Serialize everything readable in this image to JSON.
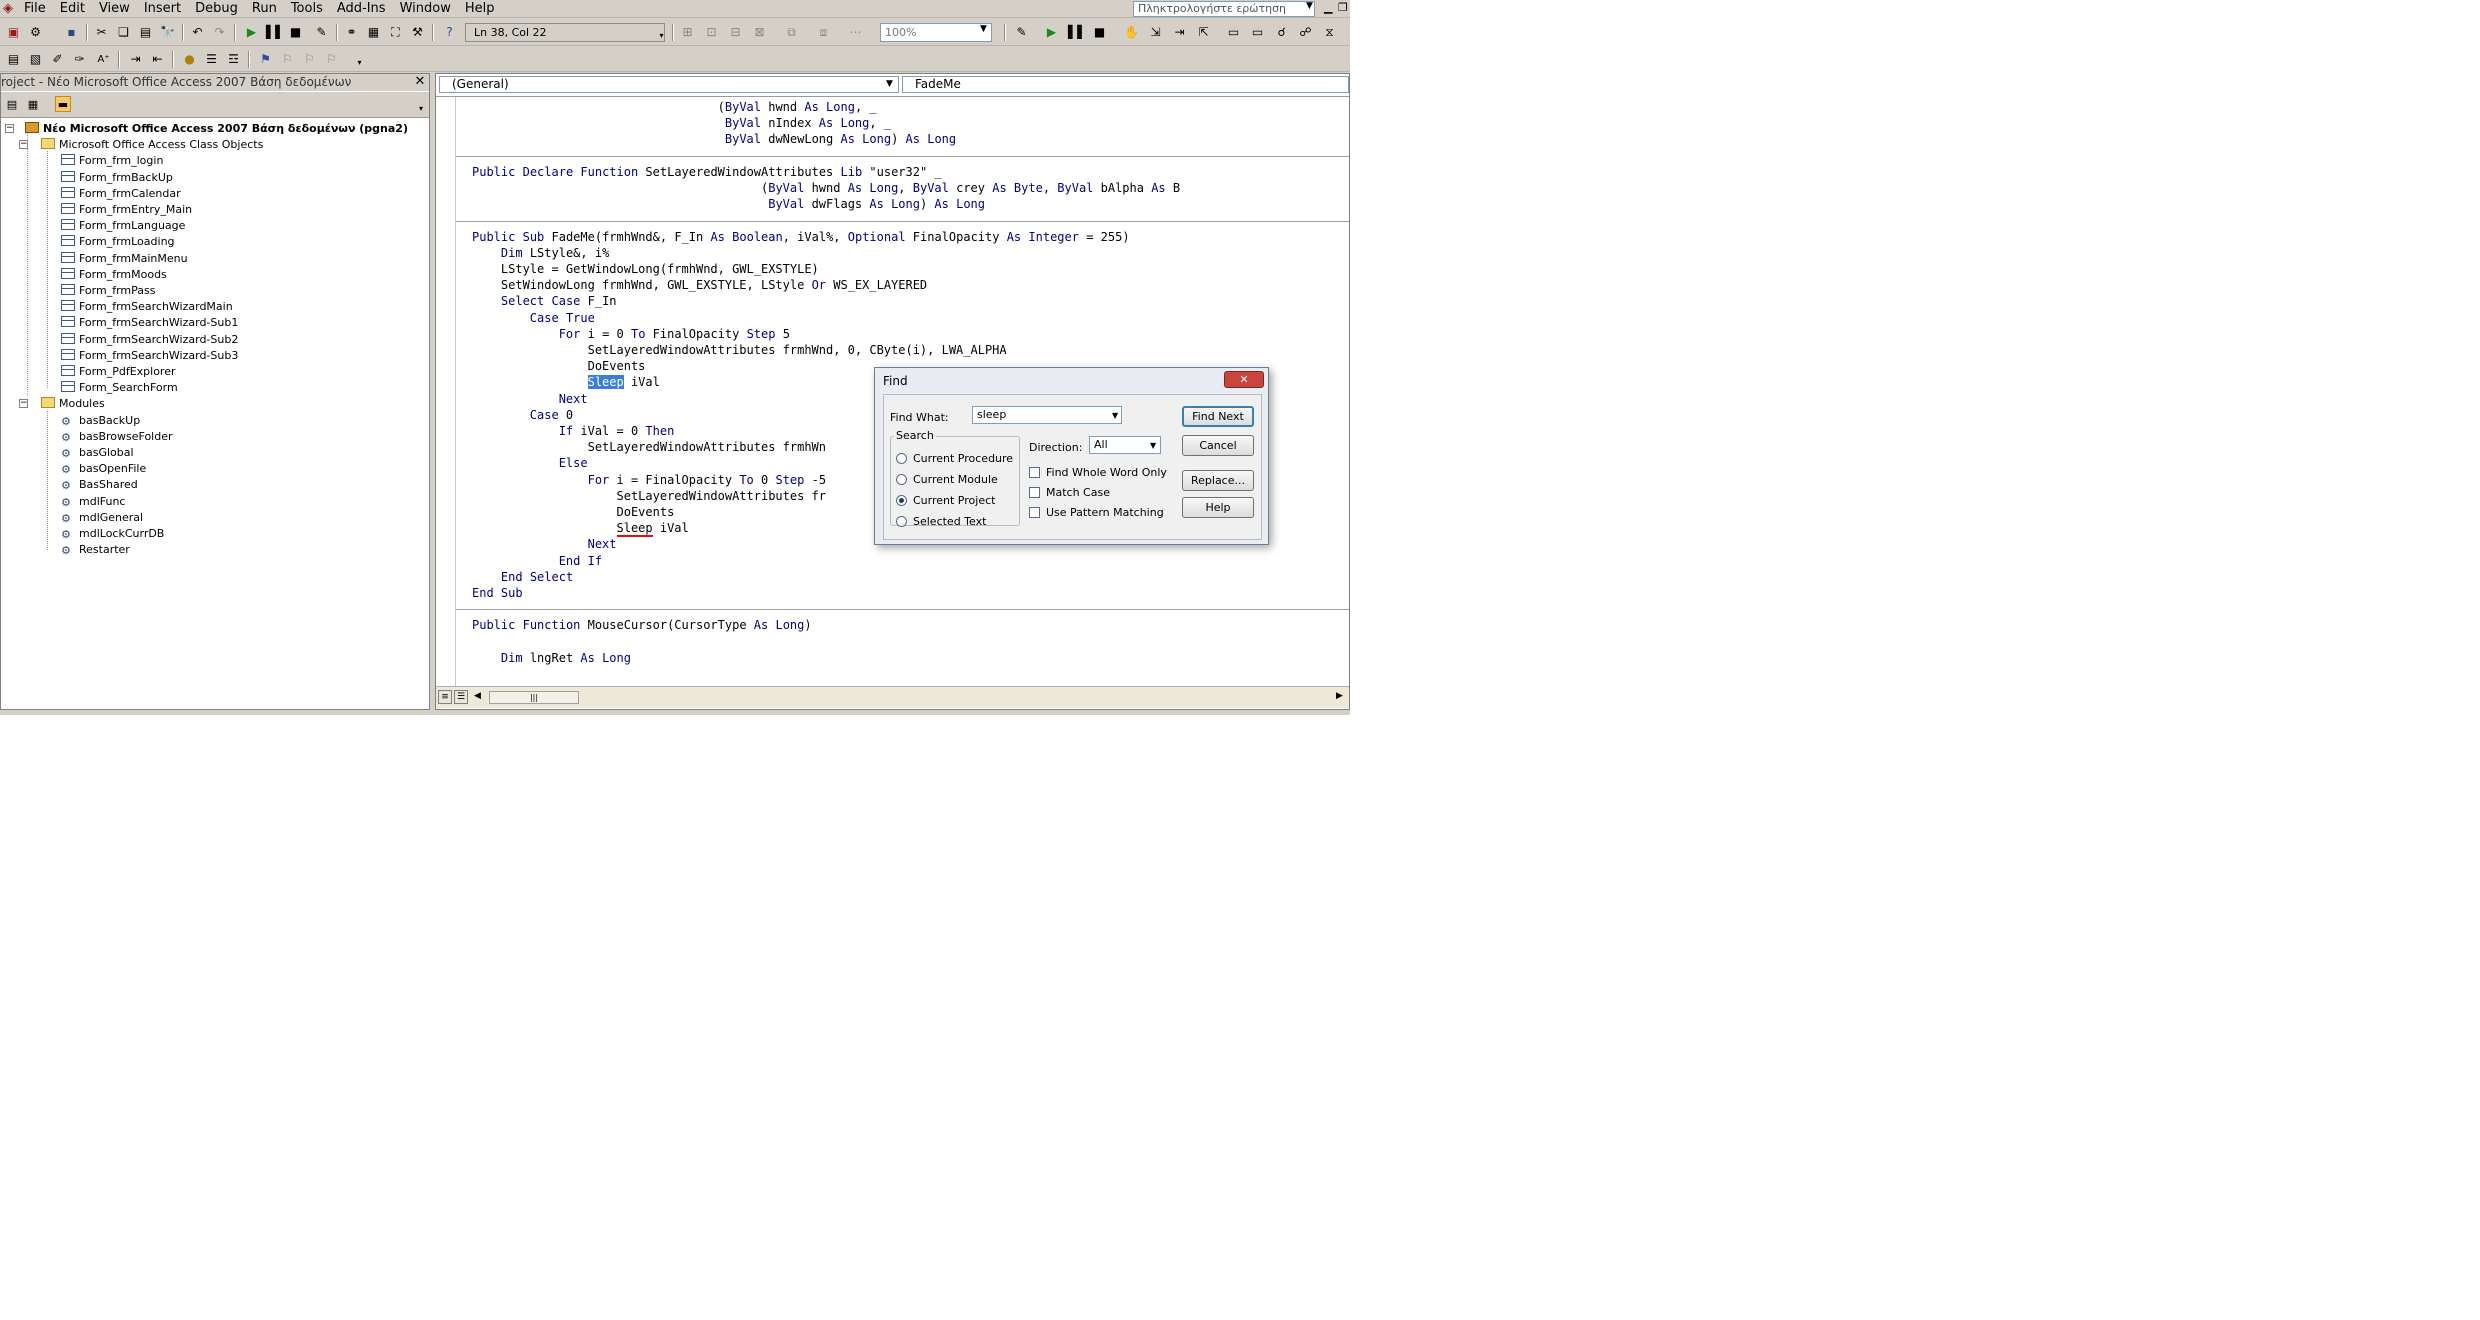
{
  "menubar": {
    "items": [
      {
        "label": "File",
        "key": "F"
      },
      {
        "label": "Edit",
        "key": "E"
      },
      {
        "label": "View",
        "key": "V"
      },
      {
        "label": "Insert",
        "key": "I"
      },
      {
        "label": "Debug",
        "key": "D"
      },
      {
        "label": "Run",
        "key": "R"
      },
      {
        "label": "Tools",
        "key": "T"
      },
      {
        "label": "Add-Ins",
        "key": "A"
      },
      {
        "label": "Window",
        "key": "W"
      },
      {
        "label": "Help",
        "key": "H"
      }
    ],
    "ask_placeholder": "Πληκτρολογήστε ερώτηση"
  },
  "toolbar": {
    "cursor_position": "Ln 38, Col 22",
    "zoom": "100%"
  },
  "project": {
    "title": "roject - Νέο Microsoft Office Access 2007 Βάση δεδομένων",
    "root": "Νέο Microsoft Office Access 2007 Βάση δεδομένων (pgna2)",
    "class_folder": "Microsoft Office Access Class Objects",
    "forms": [
      "Form_frm_login",
      "Form_frmBackUp",
      "Form_frmCalendar",
      "Form_frmEntry_Main",
      "Form_frmLanguage",
      "Form_frmLoading",
      "Form_frmMainMenu",
      "Form_frmMoods",
      "Form_frmPass",
      "Form_frmSearchWizardMain",
      "Form_frmSearchWizard-Sub1",
      "Form_frmSearchWizard-Sub2",
      "Form_frmSearchWizard-Sub3",
      "Form_PdfExplorer",
      "Form_SearchForm"
    ],
    "modules_folder": "Modules",
    "modules": [
      "basBackUp",
      "basBrowseFolder",
      "basGlobal",
      "basOpenFile",
      "BasShared",
      "mdlFunc",
      "mdlGeneral",
      "mdlLockCurrDB",
      "Restarter"
    ]
  },
  "code": {
    "object_combo": "(General)",
    "proc_combo": "FadeMe",
    "lines": [
      "                                  (ByVal hwnd As Long, _",
      "                                   ByVal nIndex As Long, _",
      "                                   ByVal dwNewLong As Long) As Long",
      "",
      "Public Declare Function SetLayeredWindowAttributes Lib \"user32\" _",
      "                                        (ByVal hwnd As Long, ByVal crey As Byte, ByVal bAlpha As B",
      "                                         ByVal dwFlags As Long) As Long",
      "",
      "Public Sub FadeMe(frmhWnd&, F_In As Boolean, iVal%, Optional FinalOpacity As Integer = 255)",
      "    Dim LStyle&, i%",
      "    LStyle = GetWindowLong(frmhWnd, GWL_EXSTYLE)",
      "    SetWindowLong frmhWnd, GWL_EXSTYLE, LStyle Or WS_EX_LAYERED",
      "    Select Case F_In",
      "        Case True",
      "            For i = 0 To FinalOpacity Step 5",
      "                SetLayeredWindowAttributes frmhWnd, 0, CByte(i), LWA_ALPHA",
      "                DoEvents",
      "                Sleep iVal",
      "            Next",
      "        Case 0",
      "            If iVal = 0 Then",
      "                SetLayeredWindowAttributes frmhWn",
      "            Else",
      "                For i = FinalOpacity To 0 Step -5",
      "                    SetLayeredWindowAttributes fr",
      "                    DoEvents",
      "                    Sleep iVal",
      "                Next",
      "            End If",
      "    End Select",
      "End Sub",
      "",
      "Public Function MouseCursor(CursorType As Long)",
      "",
      "    Dim lngRet As Long"
    ]
  },
  "find_dialog": {
    "title": "Find",
    "find_what_label": "Find What:",
    "find_what_value": "sleep",
    "search_label": "Search",
    "options": [
      "Current Procedure",
      "Current Module",
      "Current Project",
      "Selected Text"
    ],
    "selected_option": "Current Project",
    "direction_label": "Direction:",
    "direction_value": "All",
    "checkboxes": [
      "Find Whole Word Only",
      "Match Case",
      "Use Pattern Matching"
    ],
    "buttons": {
      "find_next": "Find Next",
      "cancel": "Cancel",
      "replace": "Replace...",
      "help": "Help"
    }
  },
  "colors": {
    "keyword": "#00007f",
    "selection": "#3a7ed6",
    "chrome": "#d4d0c8"
  }
}
